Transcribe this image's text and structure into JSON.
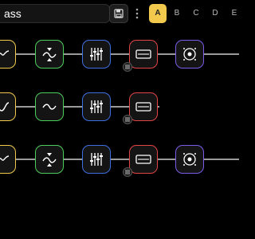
{
  "preset": {
    "name": "ass"
  },
  "snapshots": [
    "A",
    "B",
    "C",
    "D",
    "E"
  ],
  "active_snapshot": "A",
  "colors": {
    "amp": "#f2c94c",
    "filter": "#4ccd5a",
    "eq": "#3d6fe0",
    "cab": "#e04646",
    "speaker": "#7b5ce6",
    "active_snapshot": "#f2c94c"
  },
  "chains": [
    {
      "row": 1,
      "blocks": [
        "amp-sine",
        "filter-sweep",
        "eq-sliders",
        "cab-unit",
        "speaker"
      ]
    },
    {
      "row": 2,
      "blocks": [
        "amp-sine",
        "filter-sweep",
        "eq-sliders",
        "cab-unit"
      ]
    },
    {
      "row": 3,
      "blocks": [
        "amp-sine",
        "filter-sweep",
        "eq-sliders",
        "cab-unit",
        "speaker"
      ]
    }
  ]
}
